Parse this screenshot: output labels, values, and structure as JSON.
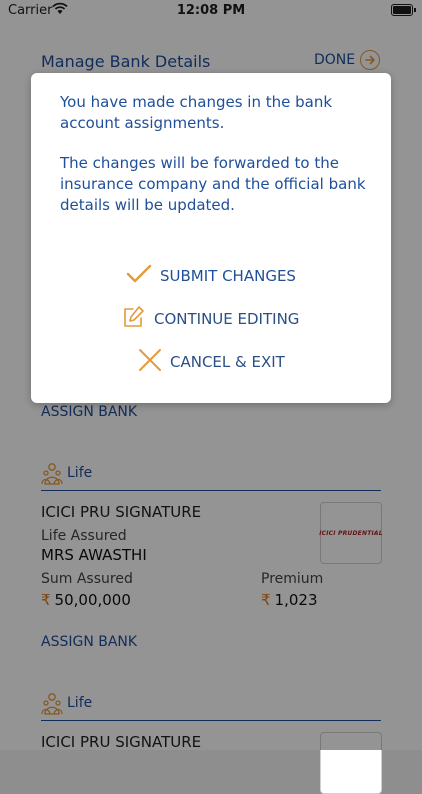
{
  "status_bar": {
    "carrier": "Carrier",
    "time": "12:08 PM"
  },
  "header": {
    "title": "Manage Bank Details",
    "done_label": "DONE"
  },
  "assign_label": "ASSIGN BANK",
  "policies": [
    {
      "category": "Life",
      "plan_name": "ICICI PRU SIGNATURE",
      "life_assured_label": "Life Assured",
      "life_assured_value": "MRS AWASTHI",
      "sum_assured_label": "Sum Assured",
      "sum_assured_value": "50,00,000",
      "premium_label": "Premium",
      "premium_value": "1,023",
      "logo_text": "ICICI PRUDENTIAL"
    },
    {
      "category": "Life",
      "plan_name": "ICICI PRU SIGNATURE"
    }
  ],
  "currency_symbol": "₹",
  "modal": {
    "message_1": "You have made changes in the bank account assignments.",
    "message_2": "The changes will be forwarded to the insurance company and the official bank details will be updated.",
    "submit_label": "SUBMIT CHANGES",
    "continue_label": "CONTINUE EDITING",
    "cancel_label": "CANCEL & EXIT"
  },
  "colors": {
    "primary": "#1f4f9a",
    "accent": "#e59a3b",
    "overlay": "rgba(0,0,0,0.42)"
  }
}
